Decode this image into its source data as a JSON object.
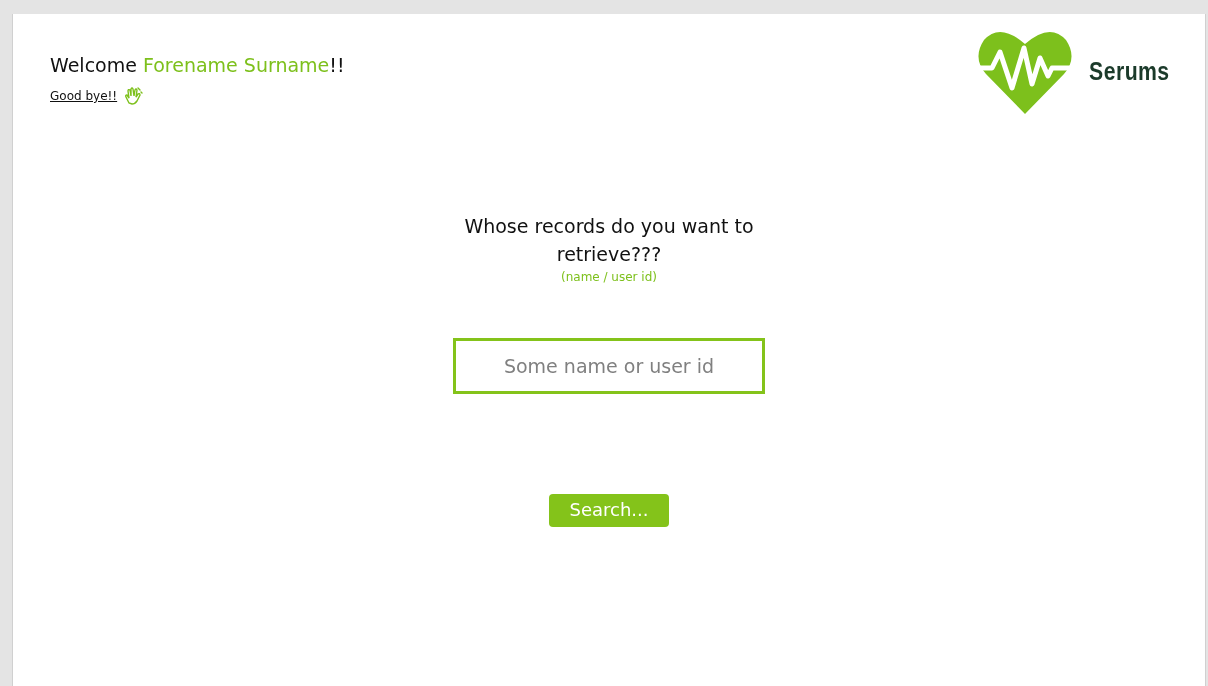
{
  "header": {
    "greeting": "Welcome ",
    "user_name": "Forename Surname",
    "greeting_end": "!!",
    "logout_link": "Good bye!!"
  },
  "logo": {
    "name": "Serums"
  },
  "search": {
    "question": "Whose records do you want to retrieve???",
    "hint": "(name / user id)",
    "placeholder": "Some name or user id",
    "button": "Search..."
  }
}
